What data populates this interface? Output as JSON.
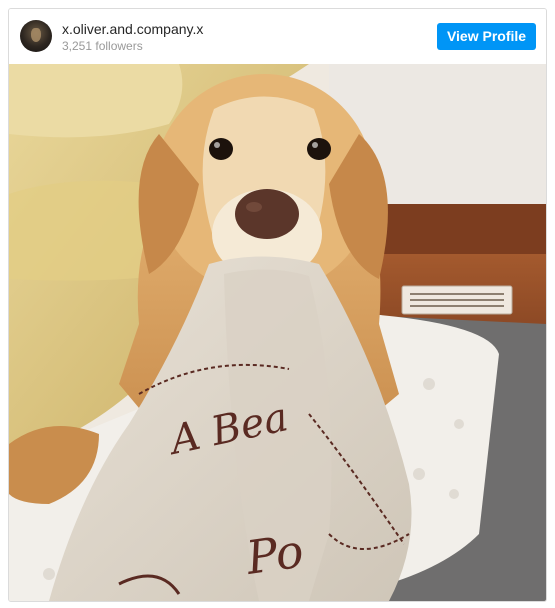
{
  "post_header": {
    "username": "x.oliver.and.company.x",
    "followers": "3,251 followers",
    "view_profile_label": "View Profile"
  },
  "avatar": {
    "icon": "dog-avatar"
  },
  "photo": {
    "blanket_text_line1": "A Bea",
    "blanket_text_line2": "Po"
  },
  "colors": {
    "accent": "#0095f6",
    "border": "#dbdbdb",
    "username": "#262626",
    "muted": "#999999"
  }
}
